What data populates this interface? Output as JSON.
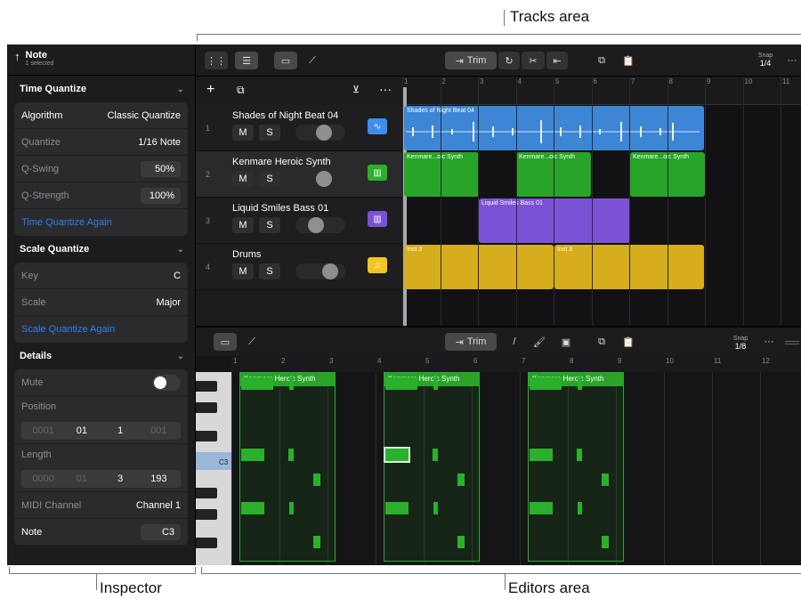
{
  "callouts": {
    "tracks_area": "Tracks area",
    "inspector": "Inspector",
    "editors_area": "Editors area"
  },
  "inspector": {
    "title": "Note",
    "subtitle": "1 selected",
    "time_quantize": {
      "header": "Time Quantize",
      "algorithm_label": "Algorithm",
      "algorithm_value": "Classic Quantize",
      "quantize_label": "Quantize",
      "quantize_value": "1/16 Note",
      "qswing_label": "Q-Swing",
      "qswing_value": "50%",
      "qstrength_label": "Q-Strength",
      "qstrength_value": "100%",
      "again": "Time Quantize Again"
    },
    "scale_quantize": {
      "header": "Scale Quantize",
      "key_label": "Key",
      "key_value": "C",
      "scale_label": "Scale",
      "scale_value": "Major",
      "again": "Scale Quantize Again"
    },
    "details": {
      "header": "Details",
      "mute_label": "Mute",
      "position_label": "Position",
      "position_values": [
        "0001",
        "01",
        "1",
        "001"
      ],
      "length_label": "Length",
      "length_values": [
        "0000",
        "01",
        "3",
        "193"
      ],
      "midi_channel_label": "MIDI Channel",
      "midi_channel_value": "Channel 1",
      "note_label": "Note",
      "note_value": "C3"
    }
  },
  "toolbar": {
    "trim_label": "Trim",
    "snap_label": "Snap",
    "snap_value": "1/4",
    "more": "···"
  },
  "tracks": [
    {
      "num": "1",
      "name": "Shades of Night Beat 04",
      "mute": "M",
      "solo": "S",
      "icon": "waveform-icon",
      "color": "#3d8ef0"
    },
    {
      "num": "2",
      "name": "Kenmare Heroic Synth",
      "mute": "M",
      "solo": "S",
      "icon": "keyboard-icon",
      "color": "#2bb02b"
    },
    {
      "num": "3",
      "name": "Liquid Smiles Bass 01",
      "mute": "M",
      "solo": "S",
      "icon": "keyboard-icon",
      "color": "#7b52d6"
    },
    {
      "num": "4",
      "name": "Drums",
      "mute": "M",
      "solo": "S",
      "icon": "music-note-icon",
      "color": "#f2c61f"
    }
  ],
  "ruler_numbers": [
    "1",
    "2",
    "3",
    "4",
    "5",
    "6",
    "7",
    "8",
    "9",
    "10",
    "11"
  ],
  "regions": {
    "shades": "Shades of Night Beat 04",
    "kenmare": "Kenmare...oic Synth",
    "liquid": "Liquid Smiles Bass 01",
    "inst3": "Inst 3"
  },
  "editor": {
    "trim_label": "Trim",
    "snap_label": "Snap",
    "snap_value": "1/8",
    "more": "···",
    "ruler_numbers": [
      "1",
      "2",
      "3",
      "4",
      "5",
      "6",
      "7",
      "8",
      "9",
      "10",
      "11",
      "12"
    ],
    "region_label": "Kenmare Heroic Synth",
    "c3_label": "C3"
  },
  "colors": {
    "accent_blue": "#2f7ff0",
    "audio_blue": "#3d8ef0",
    "midi_green": "#2bb02b",
    "bass_purple": "#7b52d6",
    "drums_yellow": "#e6b820"
  }
}
